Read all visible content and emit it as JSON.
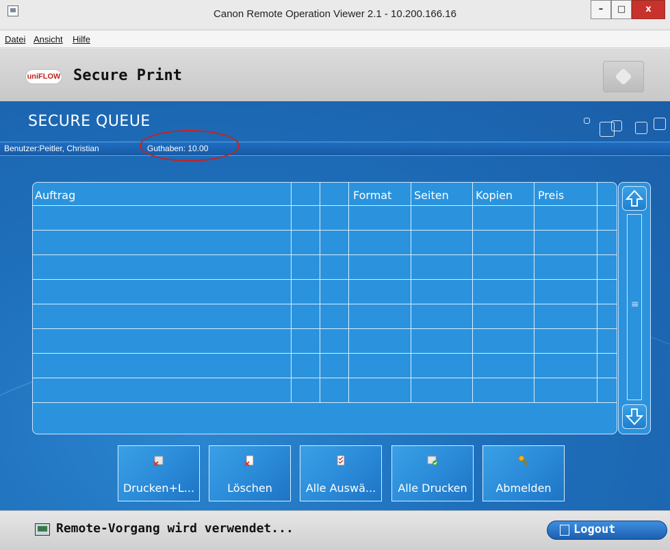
{
  "window": {
    "title": "Canon Remote Operation Viewer 2.1 - 10.200.166.16",
    "minimize": "–",
    "maximize": "□",
    "close": "x"
  },
  "menu": {
    "items": [
      "Datei",
      "Ansicht",
      "Hilfe"
    ]
  },
  "header": {
    "logo_text": "uniFLOW",
    "app_title": "Secure Print"
  },
  "queue": {
    "title": "SECURE QUEUE",
    "user_label": "Benutzer:Peitler, Christian",
    "credit_label": "Guthaben: 10.00"
  },
  "table": {
    "columns": [
      "Auftrag",
      "",
      "",
      "Format",
      "Seiten",
      "Kopien",
      "Preis",
      ""
    ],
    "rows": [
      [
        "",
        "",
        "",
        "",
        "",
        "",
        "",
        ""
      ],
      [
        "",
        "",
        "",
        "",
        "",
        "",
        "",
        ""
      ],
      [
        "",
        "",
        "",
        "",
        "",
        "",
        "",
        ""
      ],
      [
        "",
        "",
        "",
        "",
        "",
        "",
        "",
        ""
      ],
      [
        "",
        "",
        "",
        "",
        "",
        "",
        "",
        ""
      ],
      [
        "",
        "",
        "",
        "",
        "",
        "",
        "",
        ""
      ],
      [
        "",
        "",
        "",
        "",
        "",
        "",
        "",
        ""
      ],
      [
        "",
        "",
        "",
        "",
        "",
        "",
        "",
        ""
      ]
    ]
  },
  "scrollbar": {
    "up_icon": "arrow-up-icon",
    "down_icon": "arrow-down-icon",
    "grip": "≡"
  },
  "buttons": [
    {
      "label": "Drucken+L...",
      "icon": "print-delete-icon",
      "color": "#d9372b"
    },
    {
      "label": "Löschen",
      "icon": "delete-document-icon",
      "color": "#d9372b"
    },
    {
      "label": "Alle Auswä...",
      "icon": "select-all-icon",
      "color": "#b23b3b"
    },
    {
      "label": "Alle Drucken",
      "icon": "print-all-icon",
      "color": "#3aa846"
    },
    {
      "label": "Abmelden",
      "icon": "key-logout-icon",
      "color": "#e3b328"
    }
  ],
  "status": {
    "text": "Remote-Vorgang wird verwendet...",
    "logout_label": "Logout"
  },
  "colors": {
    "accent_blue": "#1e6fbb",
    "ellipse_red": "#cc1f1f"
  }
}
